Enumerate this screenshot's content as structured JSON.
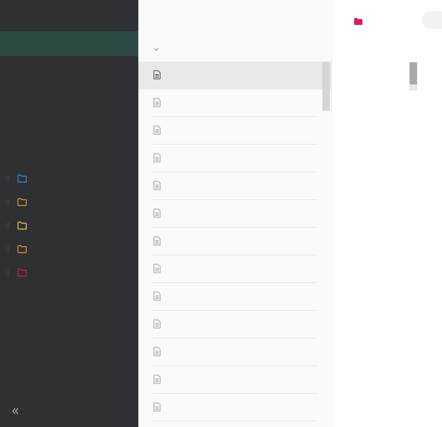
{
  "sidebar": {
    "folders": [
      {
        "icon": "folder-outline-icon",
        "color": "#3a8fd6"
      },
      {
        "icon": "folder-outline-icon",
        "color": "#e6a23c"
      },
      {
        "icon": "folder-outline-icon",
        "color": "#f2d45c"
      },
      {
        "icon": "folder-outline-icon",
        "color": "#f0a030"
      },
      {
        "icon": "folder-outline-icon",
        "color": "#d81b60"
      }
    ],
    "collapse_icon": "double-chevron-left-icon"
  },
  "note_list": {
    "sort_icon": "chevron-down-icon",
    "note_icon": "document-icon",
    "row_count": 13,
    "selected_index": 0
  },
  "editor": {
    "folder_icon": "folder-filled-icon",
    "folder_color": "#d81b60"
  },
  "colors": {
    "sidebar_bg": "#2e3033",
    "sidebar_active": "#2f4a45",
    "list_bg": "#fafafa",
    "selected_row": "#e9e9e9"
  }
}
